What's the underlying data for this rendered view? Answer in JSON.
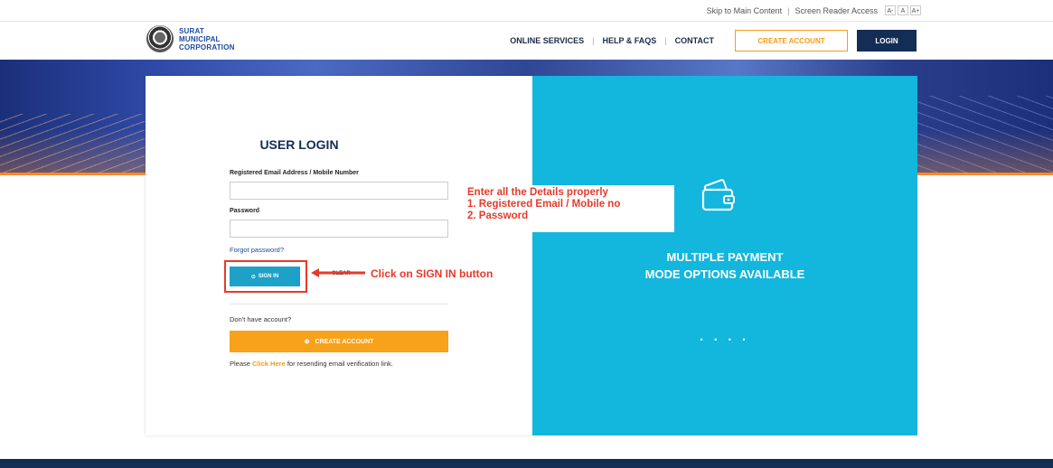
{
  "utility": {
    "skip": "Skip to Main Content",
    "sep": "|",
    "screen_reader": "Screen Reader Access",
    "font_small": "A-",
    "font_normal": "A",
    "font_large": "A+"
  },
  "header": {
    "logo_line1": "SURAT",
    "logo_line2": "MUNICIPAL",
    "logo_line3": "CORPORATION",
    "nav": [
      "ONLINE SERVICES",
      "HELP & FAQS",
      "CONTACT"
    ],
    "nav_sep": "|",
    "create_account": "CREATE ACCOUNT",
    "login": "LOGIN"
  },
  "login": {
    "title": "USER LOGIN",
    "email_label": "Registered Email Address / Mobile Number",
    "email_value": "",
    "password_label": "Password",
    "password_value": "",
    "forgot": "Forgot password?",
    "signin_icon": "⊙",
    "signin": "SIGN IN",
    "clear": "CLEAR",
    "dont_have": "Don't have account?",
    "create_icon": "⊕",
    "create": "CREATE ACCOUNT",
    "resend_pre": "Please",
    "resend_link": "Click Here",
    "resend_post": "for resending email verification link."
  },
  "promo": {
    "line1": "MULTIPLE PAYMENT",
    "line2": "MODE OPTIONS AVAILABLE",
    "dots": "• • • •",
    "icon": "wallet-icon"
  },
  "annotations": {
    "details_line1": "Enter all the Details properly",
    "details_line2": "1. Registered Email / Mobile no",
    "details_line3": "2. Password",
    "signin_note": "Click on SIGN IN button",
    "color": "#e53a2b"
  },
  "colors": {
    "navy": "#132d55",
    "accent_orange": "#f8a11a",
    "promo_cyan": "#13b6dc",
    "signin_blue": "#1da1c8"
  }
}
